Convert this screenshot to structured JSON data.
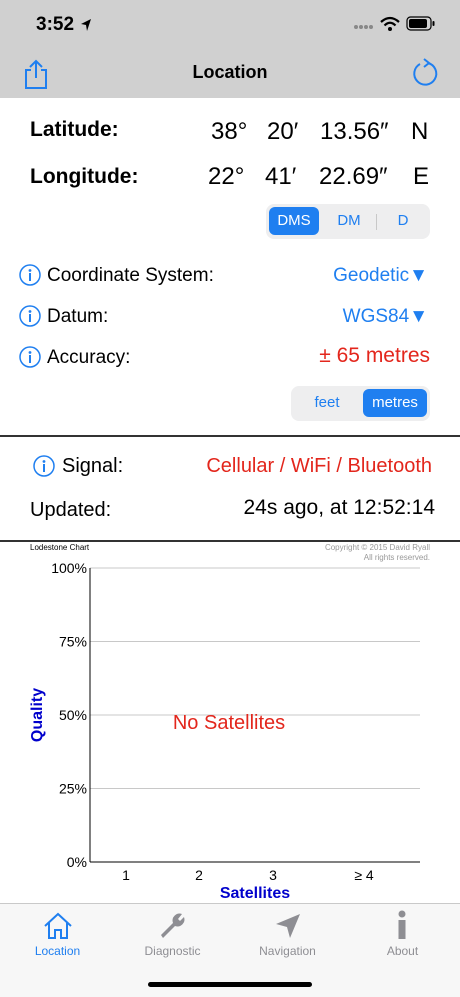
{
  "status_bar": {
    "time": "3:52"
  },
  "nav": {
    "title": "Location"
  },
  "coordinates": {
    "latitude_label": "Latitude:",
    "latitude_deg": "38°",
    "latitude_min": "20′",
    "latitude_sec": "13.56″",
    "latitude_hemi": "N",
    "longitude_label": "Longitude:",
    "longitude_deg": "22°",
    "longitude_min": "41′",
    "longitude_sec": "22.69″",
    "longitude_hemi": "E"
  },
  "format_segment": {
    "options": [
      "DMS",
      "DM",
      "D"
    ],
    "selected": "DMS"
  },
  "settings": {
    "coord_system_label": "Coordinate System:",
    "coord_system_value": "Geodetic▼",
    "datum_label": "Datum:",
    "datum_value": "WGS84▼",
    "accuracy_label": "Accuracy:",
    "accuracy_value": "± 65 metres"
  },
  "units_segment": {
    "options": [
      "feet",
      "metres"
    ],
    "selected": "metres"
  },
  "signal": {
    "label": "Signal:",
    "value": "Cellular / WiFi / Bluetooth",
    "updated_label": "Updated:",
    "updated_value": "24s ago, at 12:52:14"
  },
  "chart_meta": {
    "name": "Lodestone Chart",
    "copyright_line1": "Copyright © 2015 David Ryall",
    "copyright_line2": "All rights reserved.",
    "empty_message": "No Satellites"
  },
  "chart_data": {
    "type": "bar",
    "categories": [
      "1",
      "2",
      "3",
      "≥ 4"
    ],
    "values": [],
    "xlabel": "Satellites",
    "ylabel": "Quality",
    "yticks": [
      "0%",
      "25%",
      "50%",
      "75%",
      "100%"
    ],
    "ylim": [
      0,
      100
    ],
    "grid": true
  },
  "tabs": [
    {
      "label": "Location",
      "icon": "house-icon",
      "selected": true
    },
    {
      "label": "Diagnostic",
      "icon": "wrench-icon",
      "selected": false
    },
    {
      "label": "Navigation",
      "icon": "navigation-arrow-icon",
      "selected": false
    },
    {
      "label": "About",
      "icon": "info-icon",
      "selected": false
    }
  ],
  "colors": {
    "accent": "#1f7ff0",
    "alert": "#e3261c",
    "axis_title": "#0000cc"
  }
}
